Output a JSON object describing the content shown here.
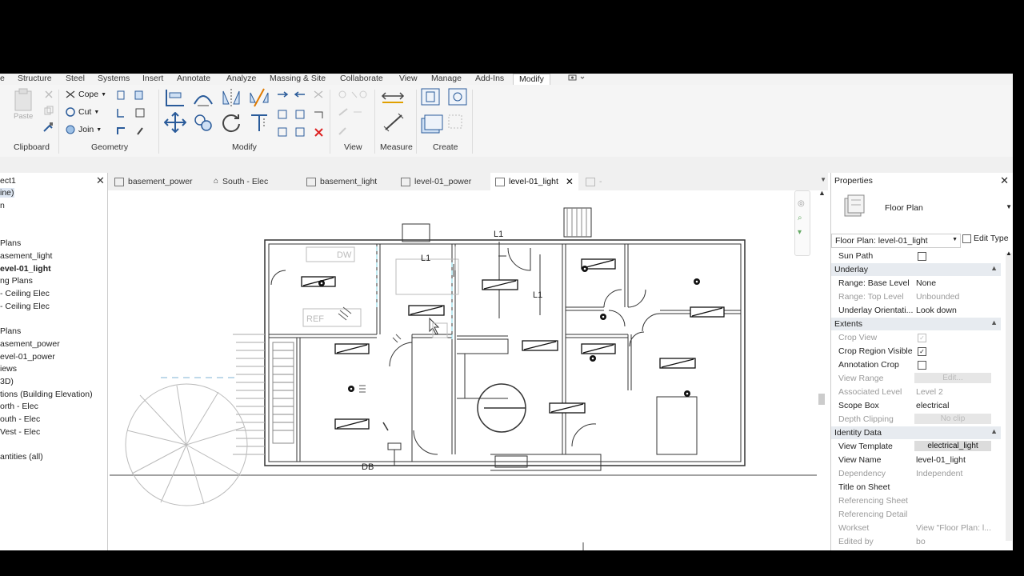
{
  "ribbon": {
    "tabs": [
      "Structure",
      "Steel",
      "Systems",
      "Insert",
      "Annotate",
      "Analyze",
      "Massing & Site",
      "Collaborate",
      "View",
      "Manage",
      "Add-Ins",
      "Modify"
    ],
    "active_tab": "Modify",
    "clipboard": {
      "paste": "Paste",
      "label": "Clipboard"
    },
    "geometry": {
      "cope": "Cope",
      "cut": "Cut",
      "join": "Join",
      "label": "Geometry"
    },
    "modify": {
      "label": "Modify"
    },
    "view": {
      "label": "View"
    },
    "measure": {
      "label": "Measure"
    },
    "create": {
      "label": "Create"
    }
  },
  "browser": {
    "title": "ect1",
    "items": [
      "ine)",
      "n",
      "Plans",
      "asement_light",
      "evel-01_light",
      "ng Plans",
      "- Ceiling Elec",
      "- Ceiling Elec",
      "Plans",
      "asement_power",
      "evel-01_power",
      "iews",
      "3D)",
      "tions (Building Elevation)",
      "orth - Elec",
      "outh - Elec",
      "Vest - Elec",
      "antities (all)"
    ]
  },
  "view_tabs": [
    "basement_power",
    "South - Elec",
    "basement_light",
    "level-01_power",
    "level-01_light",
    "-"
  ],
  "active_view": "level-01_light",
  "canvas": {
    "labels": {
      "l1_top": "L1",
      "l1_mid": "L1",
      "l1_right": "L1",
      "dw": "DW",
      "ref": "REF",
      "db": "DB"
    }
  },
  "properties": {
    "title": "Properties",
    "type_name": "Floor Plan",
    "selector": "Floor Plan: level-01_light",
    "edit_type": "Edit Type",
    "rows": [
      {
        "k": "Sun Path",
        "v": "",
        "kind": "check",
        "checked": false
      },
      {
        "section": "Underlay"
      },
      {
        "k": "Range: Base Level",
        "v": "None"
      },
      {
        "k": "Range: Top Level",
        "v": "Unbounded",
        "dim": true
      },
      {
        "k": "Underlay Orientati...",
        "v": "Look down"
      },
      {
        "section": "Extents"
      },
      {
        "k": "Crop View",
        "v": "",
        "kind": "check",
        "checked": true,
        "dim": true
      },
      {
        "k": "Crop Region Visible",
        "v": "",
        "kind": "check",
        "checked": true
      },
      {
        "k": "Annotation Crop",
        "v": "",
        "kind": "check",
        "checked": false
      },
      {
        "k": "View Range",
        "v": "Edit...",
        "kind": "btn",
        "dim": true
      },
      {
        "k": "Associated Level",
        "v": "Level 2",
        "dim": true
      },
      {
        "k": "Scope Box",
        "v": "electrical"
      },
      {
        "k": "Depth Clipping",
        "v": "No clip",
        "kind": "btn",
        "dim": true
      },
      {
        "section": "Identity Data"
      },
      {
        "k": "View Template",
        "v": "electrical_light",
        "kind": "btn",
        "on": true
      },
      {
        "k": "View Name",
        "v": "level-01_light"
      },
      {
        "k": "Dependency",
        "v": "Independent",
        "dim": true
      },
      {
        "k": "Title on Sheet",
        "v": ""
      },
      {
        "k": "Referencing Sheet",
        "v": "",
        "dim": true
      },
      {
        "k": "Referencing Detail",
        "v": "",
        "dim": true
      },
      {
        "k": "Workset",
        "v": "View \"Floor Plan: l...",
        "dim": true
      },
      {
        "k": "Edited by",
        "v": "bo",
        "dim": true
      }
    ]
  },
  "colors": {
    "accent": "#2a5b9a",
    "ribbon_bg": "#f5f5f5"
  }
}
